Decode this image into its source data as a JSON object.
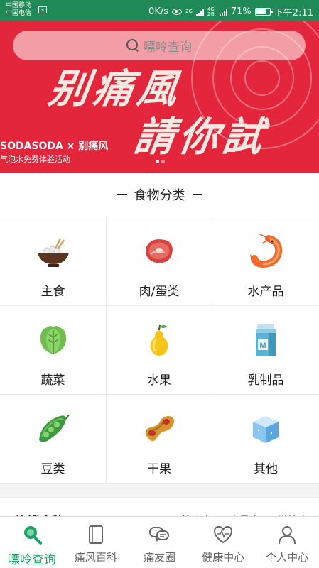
{
  "status_bar": {
    "carrier1": "中国移动",
    "carrier2": "中国电信",
    "speed": "0K/s",
    "battery": "71%",
    "time": "下午2:11",
    "signal1": "2G",
    "signal2": "4G 2G"
  },
  "search": {
    "placeholder": "嘌呤查询"
  },
  "banner": {
    "line1": "别痛風",
    "line2": "請你試",
    "brand": "SODASODA × 别痛风",
    "subtitle": "气泡水免费体验活动",
    "page_count": 2,
    "active_page": 1
  },
  "categories": {
    "title": "食物分类",
    "items": [
      {
        "label": "主食",
        "icon": "rice-bowl-icon"
      },
      {
        "label": "肉/蛋类",
        "icon": "meat-icon"
      },
      {
        "label": "水产品",
        "icon": "shrimp-icon"
      },
      {
        "label": "蔬菜",
        "icon": "lettuce-icon"
      },
      {
        "label": "水果",
        "icon": "pear-icon"
      },
      {
        "label": "乳制品",
        "icon": "milk-carton-icon"
      },
      {
        "label": "豆类",
        "icon": "peas-icon"
      },
      {
        "label": "干果",
        "icon": "peanut-icon"
      },
      {
        "label": "其他",
        "icon": "cube-icon"
      }
    ]
  },
  "hot_foods": {
    "title": "热搜食物",
    "legend": [
      {
        "label": "放心吃",
        "color": "#2bbf8a"
      },
      {
        "label": "少量吃",
        "color": "#f0b43a"
      },
      {
        "label": "谨慎吃",
        "color": "#e8504a"
      }
    ]
  },
  "tabbar": {
    "tabs": [
      {
        "label": "嘌呤查询",
        "icon": "search-icon",
        "active": true
      },
      {
        "label": "痛风百科",
        "icon": "book-icon",
        "active": false
      },
      {
        "label": "痛友圈",
        "icon": "chat-bubbles-icon",
        "active": false
      },
      {
        "label": "健康中心",
        "icon": "heart-pulse-icon",
        "active": false
      },
      {
        "label": "个人中心",
        "icon": "person-icon",
        "active": false
      }
    ]
  },
  "colors": {
    "status_bar": "#1f8a55",
    "banner": "#e4263c",
    "accent": "#1aa567"
  }
}
